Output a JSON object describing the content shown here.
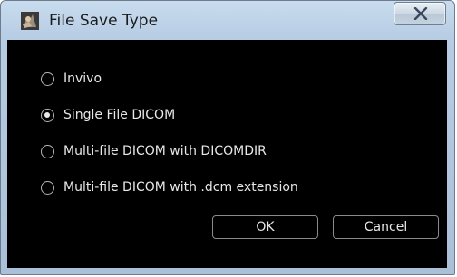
{
  "window": {
    "title": "File Save Type",
    "icons": {
      "app": "app-icon",
      "close": "close-icon"
    }
  },
  "options": [
    {
      "label": "Invivo",
      "checked": false
    },
    {
      "label": "Single File DICOM",
      "checked": true
    },
    {
      "label": "Multi-file DICOM with DICOMDIR",
      "checked": false
    },
    {
      "label": "Multi-file DICOM with .dcm extension",
      "checked": false
    }
  ],
  "buttons": {
    "ok_label": "OK",
    "cancel_label": "Cancel"
  },
  "colors": {
    "client_background": "#000000",
    "text": "#e8e8e8",
    "frame": "#b7cde4"
  }
}
